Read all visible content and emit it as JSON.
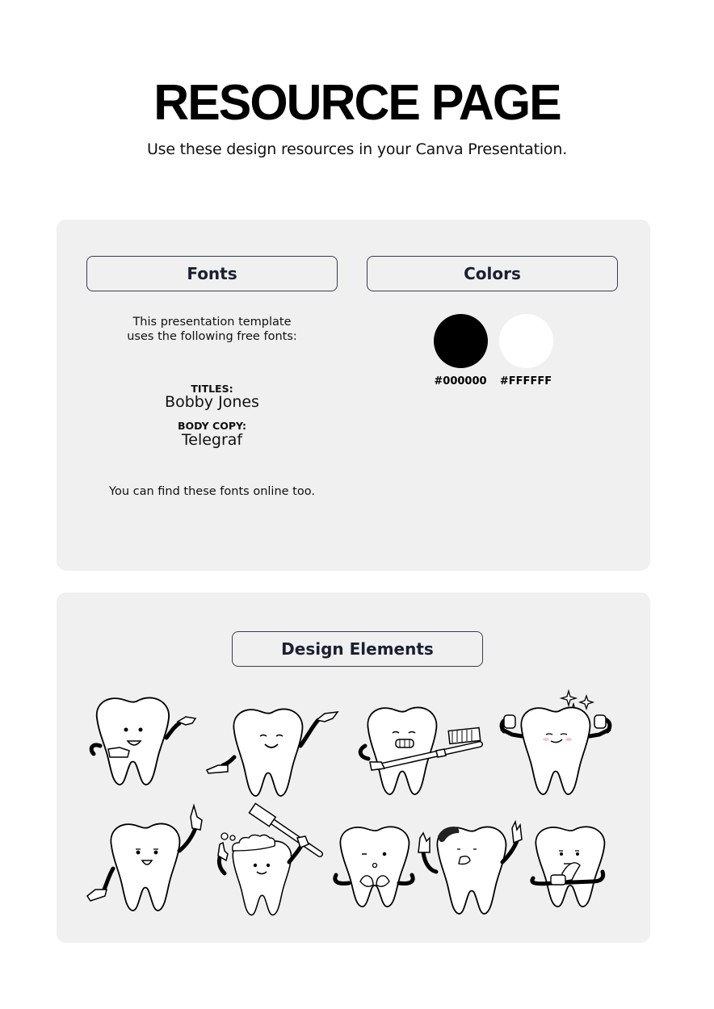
{
  "header": {
    "title": "RESOURCE PAGE",
    "subtitle": "Use these design resources in your Canva Presentation."
  },
  "fonts_section": {
    "heading": "Fonts",
    "intro_line1": "This presentation template",
    "intro_line2": "uses the following free fonts:",
    "titles_label": "TITLES:",
    "titles_font": "Bobby Jones",
    "body_label": "BODY COPY:",
    "body_font": "Telegraf",
    "footer": "You can find these fonts online too."
  },
  "colors_section": {
    "heading": "Colors",
    "swatches": [
      {
        "hex": "#000000",
        "label": "#000000"
      },
      {
        "hex": "#FFFFFF",
        "label": "#FFFFFF"
      }
    ]
  },
  "design_elements": {
    "heading": "Design Elements",
    "items": [
      {
        "name": "tooth-presenting-happy"
      },
      {
        "name": "tooth-smiling-open-arms"
      },
      {
        "name": "tooth-holding-toothbrush"
      },
      {
        "name": "tooth-sparkling-flexing"
      },
      {
        "name": "tooth-pointing-up"
      },
      {
        "name": "tooth-brushing-foam"
      },
      {
        "name": "tooth-heart-hands"
      },
      {
        "name": "tooth-with-cavity-waving"
      },
      {
        "name": "tooth-thinking"
      }
    ]
  }
}
